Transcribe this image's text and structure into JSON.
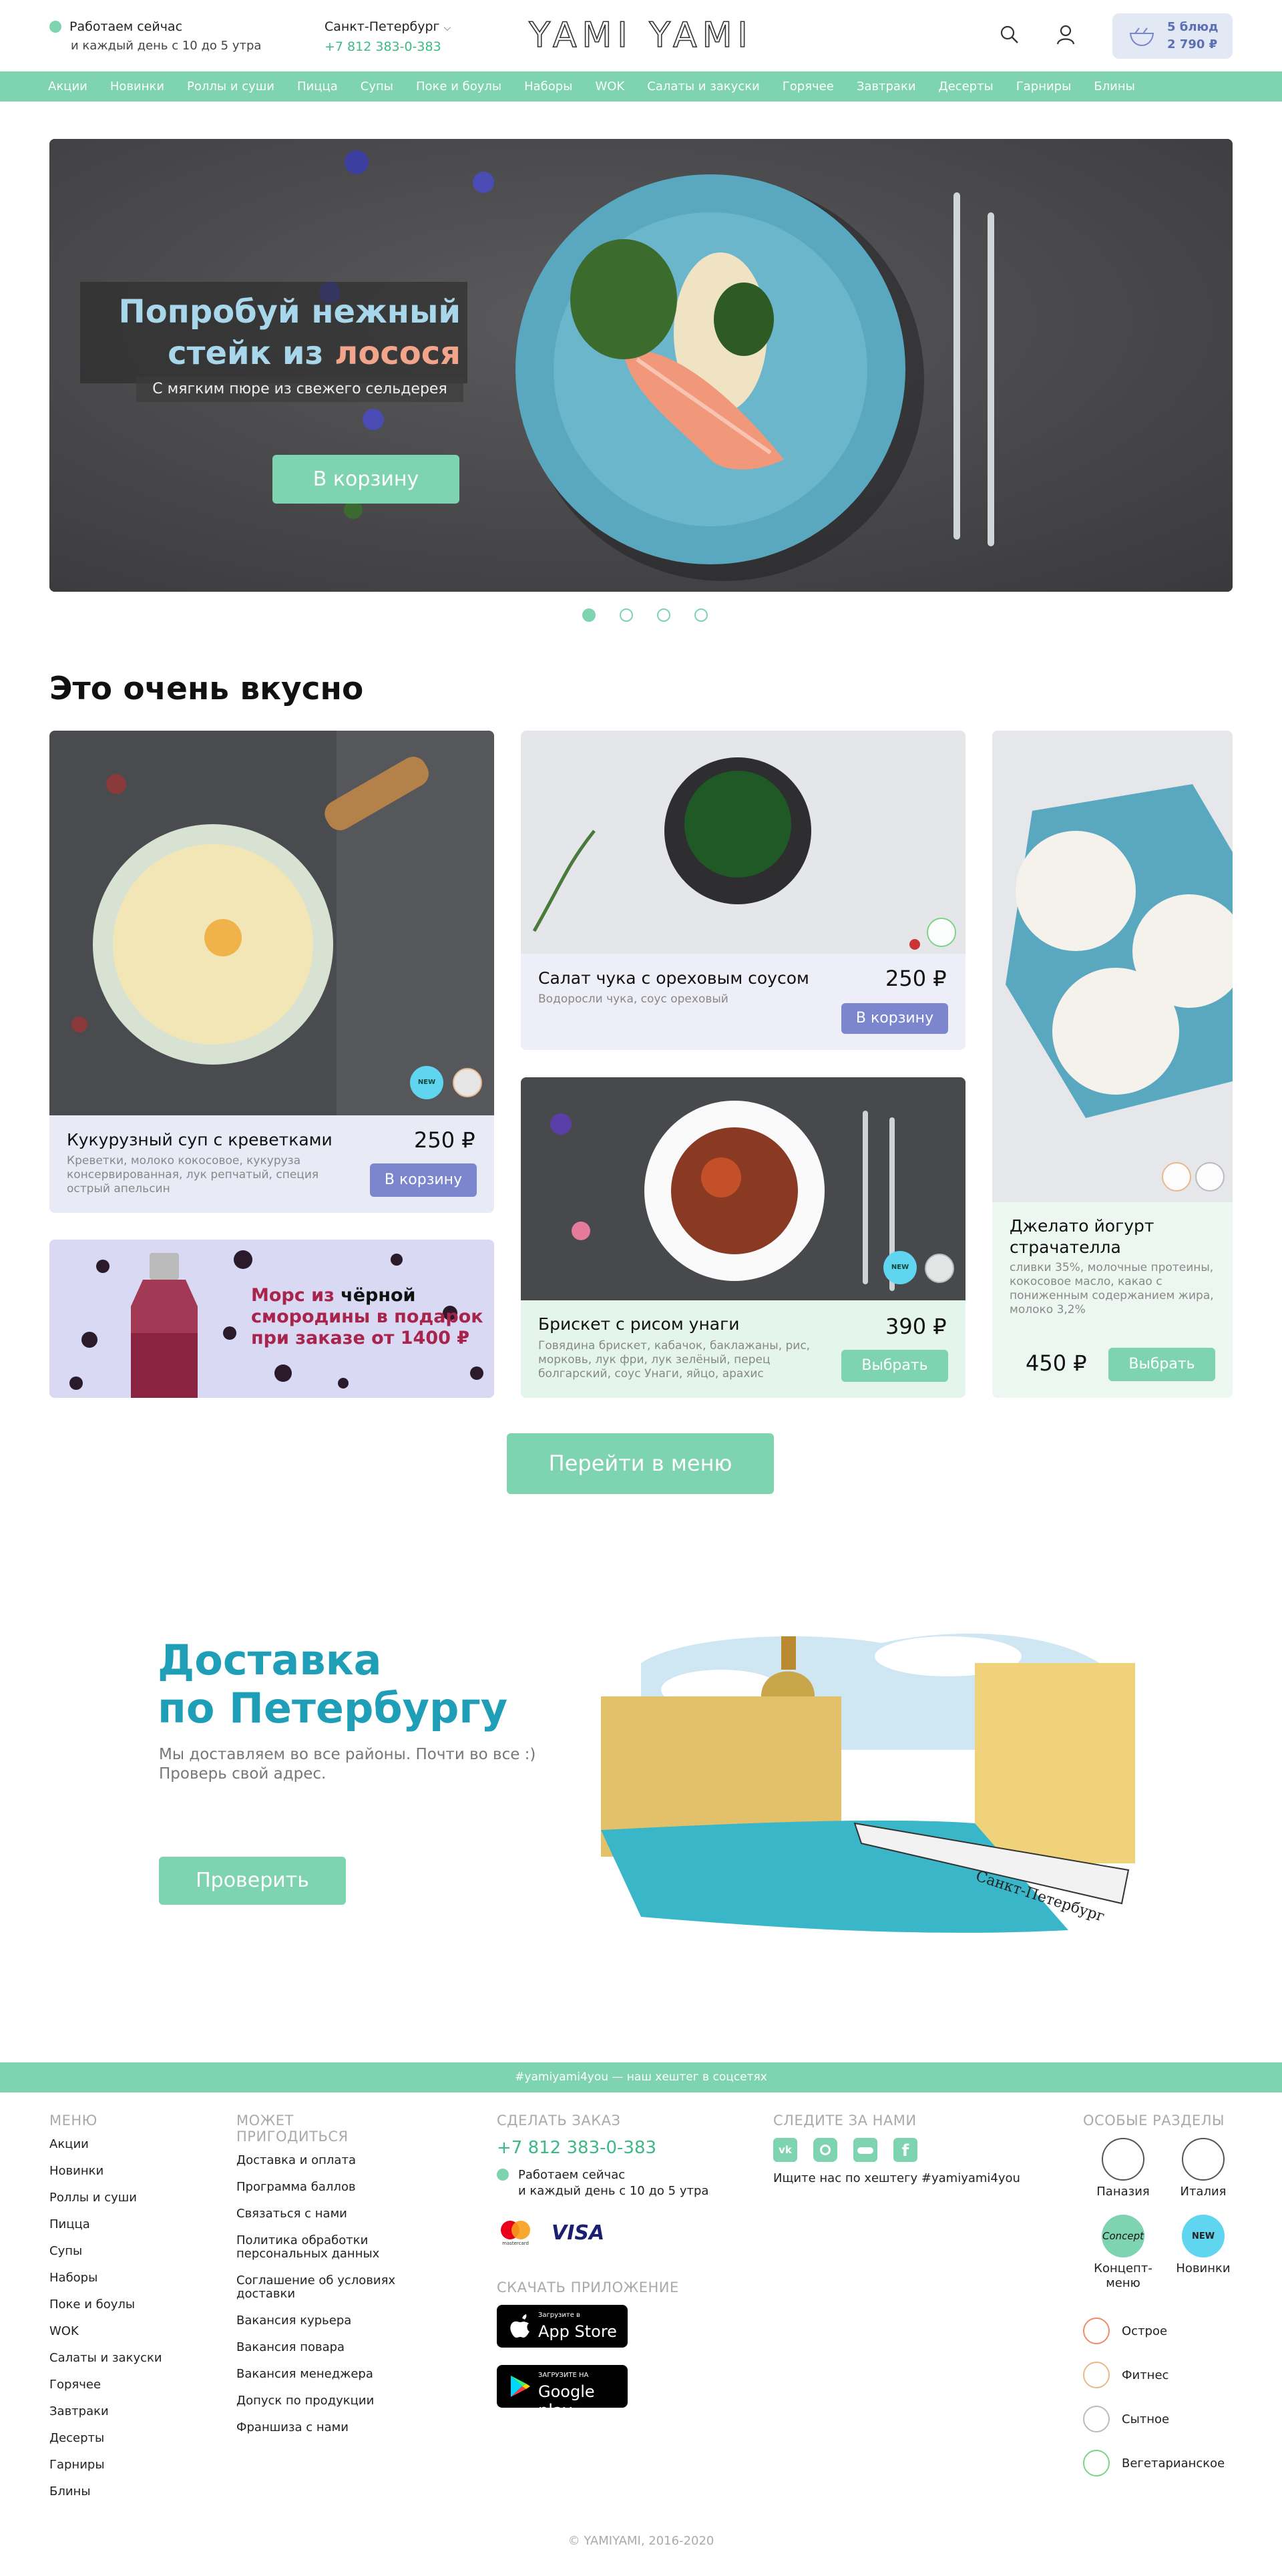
{
  "header": {
    "work_status": "Работаем сейчас",
    "work_hours": "и каждый день с 10 до 5 утра",
    "city": "Санкт-Петербург",
    "phone": "+7 812 383-0-383",
    "logo": "YAMI YAMI",
    "cart_count": "5 блюд",
    "cart_total": "2 790 ₽"
  },
  "nav": [
    "Акции",
    "Новинки",
    "Роллы и суши",
    "Пицца",
    "Супы",
    "Поке и боулы",
    "Наборы",
    "WOK",
    "Салаты и закуски",
    "Горячее",
    "Завтраки",
    "Десерты",
    "Гарниры",
    "Блины"
  ],
  "hero": {
    "title_line1": "Попробуй нежный",
    "title_line2_a": "стейк из ",
    "title_line2_b": "лосося",
    "subtitle": "С мягким пюре из свежего сельдерея",
    "button": "В корзину",
    "slides_total": 4,
    "slide_active": 1
  },
  "section": {
    "title": "Это очень вкусно",
    "menu_button": "Перейти в меню"
  },
  "products": [
    {
      "name": "Кукурузный суп с креветками",
      "desc": "Креветки, молоко кокосовое, кукуруза консервированная, лук репчатый, специя острый апельсин",
      "price": "250 ₽",
      "button": "В корзину"
    },
    {
      "name": "Салат чука с ореховым соусом",
      "desc": "Водоросли чука, соус ореховый",
      "price": "250 ₽",
      "button": "В корзину"
    },
    {
      "name": "Брискет с рисом унаги",
      "desc": "Говядина брискет, кабачок, баклажаны, рис, морковь, лук фри, лук зелёный, перец болгарский, соус Унаги, яйцо, арахис",
      "price": "390 ₽",
      "button": "Выбрать"
    },
    {
      "name": "Джелато йогурт страчателла",
      "desc": "сливки 35%, молочные протеины, кокосовое масло, какао с пониженным содержанием жира, молоко 3,2%",
      "price": "450 ₽",
      "button": "Выбрать"
    }
  ],
  "badges": {
    "new": "NEW"
  },
  "promo": {
    "line1_a": "Морс из ",
    "line1_b": "чёрной",
    "line2": "смородины в подарок",
    "line3": "при заказе от 1400 ₽"
  },
  "delivery": {
    "title_line1": "Доставка",
    "title_line2": "по Петербургу",
    "text_line1": "Мы доставляем во все районы. Почти во все :)",
    "text_line2": "Проверь свой адрес.",
    "button": "Проверить",
    "map_sign": "Санкт-Петербург"
  },
  "footer": {
    "hashtag_bar": "#yamiyami4you — наш хештег в соцсетях",
    "menu_head": "МЕНЮ",
    "menu_items": [
      "Акции",
      "Новинки",
      "Роллы и суши",
      "Пицца",
      "Супы",
      "Наборы",
      "Поке и боулы",
      "WOK",
      "Салаты и закуски",
      "Горячее",
      "Завтраки",
      "Десерты",
      "Гарниры",
      "Блины"
    ],
    "useful_head": "МОЖЕТ ПРИГОДИТЬСЯ",
    "useful_items": [
      "Доставка и оплата",
      "Программа баллов",
      "Связаться с нами",
      "Политика обработки персональных данных",
      "Соглашение об условиях доставки",
      "Вакансия курьера",
      "Вакансия повара",
      "Вакансия менеджера",
      "Допуск по продукции",
      "Франшиза с нами"
    ],
    "order_head": "СДЕЛАТЬ ЗАКАЗ",
    "order_phone": "+7 812 383-0-383",
    "order_status": "Работаем сейчас",
    "order_hours": "и каждый день с 10 до 5 утра",
    "pay_mastercard": "mastercard",
    "pay_visa": "VISA",
    "app_head": "СКАЧАТЬ ПРИЛОЖЕНИЕ",
    "appstore_small": "Загрузите в",
    "appstore_big": "App Store",
    "googleplay_small": "ЗАГРУЗИТЕ НА",
    "googleplay_big": "Google play",
    "follow_head": "СЛЕДИТЕ ЗА НАМИ",
    "follow_text": "Ищите нас по хештегу #yamiyami4you",
    "special_head": "ОСОБЫЕ РАЗДЕЛЫ",
    "special": [
      "Паназия",
      "Италия",
      "Концепт-меню",
      "Новинки"
    ],
    "concept_badge": "Concept",
    "tags": [
      "Острое",
      "Фитнес",
      "Сытное",
      "Вегетарианское"
    ],
    "copyright": "© YAMIYAMI, 2016-2020"
  },
  "colors": {
    "accent": "#7ed3b0",
    "brand_blue": "#1f9eb8",
    "cart_bg": "#e3e8f5",
    "button_purple": "#7c86cf"
  }
}
